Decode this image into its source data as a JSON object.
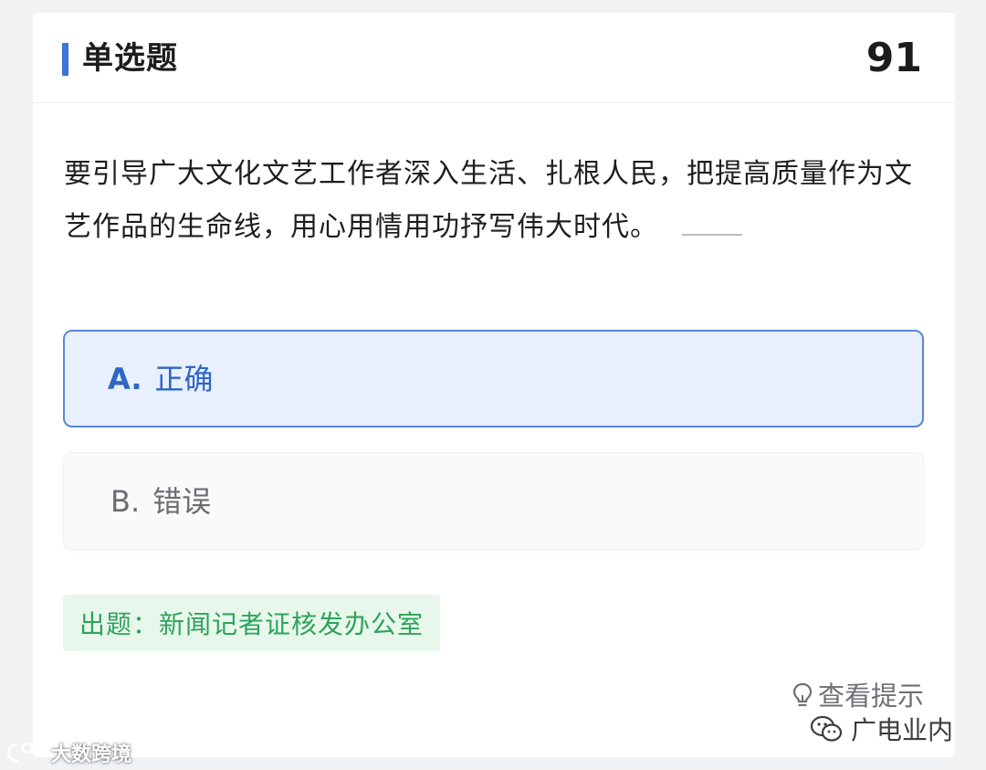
{
  "header": {
    "title": "单选题",
    "question_number": "91"
  },
  "question": {
    "text": "要引导广大文化文艺工作者深入生活、扎根人民，把提高质量作为文艺作品的生命线，用心用情用功抒写伟大时代。"
  },
  "options": [
    {
      "letter": "A.",
      "text": "正确",
      "selected": true
    },
    {
      "letter": "B.",
      "text": "错误",
      "selected": false
    }
  ],
  "source": {
    "label": "出题：新闻记者证核发办公室"
  },
  "hint": {
    "label": "查看提示",
    "icon": "lightbulb-icon"
  },
  "watermarks": {
    "left_label": "大数跨境",
    "right_label": "广电业内",
    "right_icon": "wechat-icon"
  },
  "colors": {
    "accent": "#3a74d6",
    "selected_text": "#2f66c6",
    "selected_bg": "#e8effd",
    "source_text": "#2fa35a",
    "source_bg": "#e7f7ec"
  }
}
